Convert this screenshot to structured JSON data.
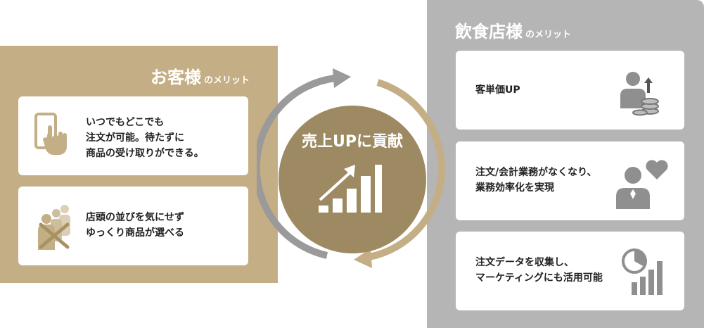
{
  "customer_panel": {
    "title": "お客様",
    "subtitle": "のメリット",
    "cards": [
      {
        "text": "いつでもどこでも\n注文が可能。待たずに\n商品の受け取りができる。",
        "icon": "smartphone-tap-icon"
      },
      {
        "text": "店頭の並びを気にせず\nゆっくり商品が選べる",
        "icon": "no-queue-icon"
      }
    ]
  },
  "restaurant_panel": {
    "title": "飲食店様",
    "subtitle": "のメリット",
    "cards": [
      {
        "text": "客単価UP",
        "icon": "person-coins-up-icon"
      },
      {
        "text": "注文/会計業務がなくなり、\n業務効率化を実現",
        "icon": "person-heart-icon"
      },
      {
        "text": "注文データを収集し、\nマーケティングにも活用可能",
        "icon": "pie-bar-chart-icon"
      }
    ]
  },
  "center": {
    "title": "売上UPに貢献",
    "icon": "growth-bar-chart-icon"
  },
  "colors": {
    "left_panel": "#c4ae85",
    "right_panel": "#b5b5b5",
    "center_circle": "#9e8a62",
    "arrow_gray": "#9a9a9a",
    "arrow_gold": "#c4ae85"
  }
}
